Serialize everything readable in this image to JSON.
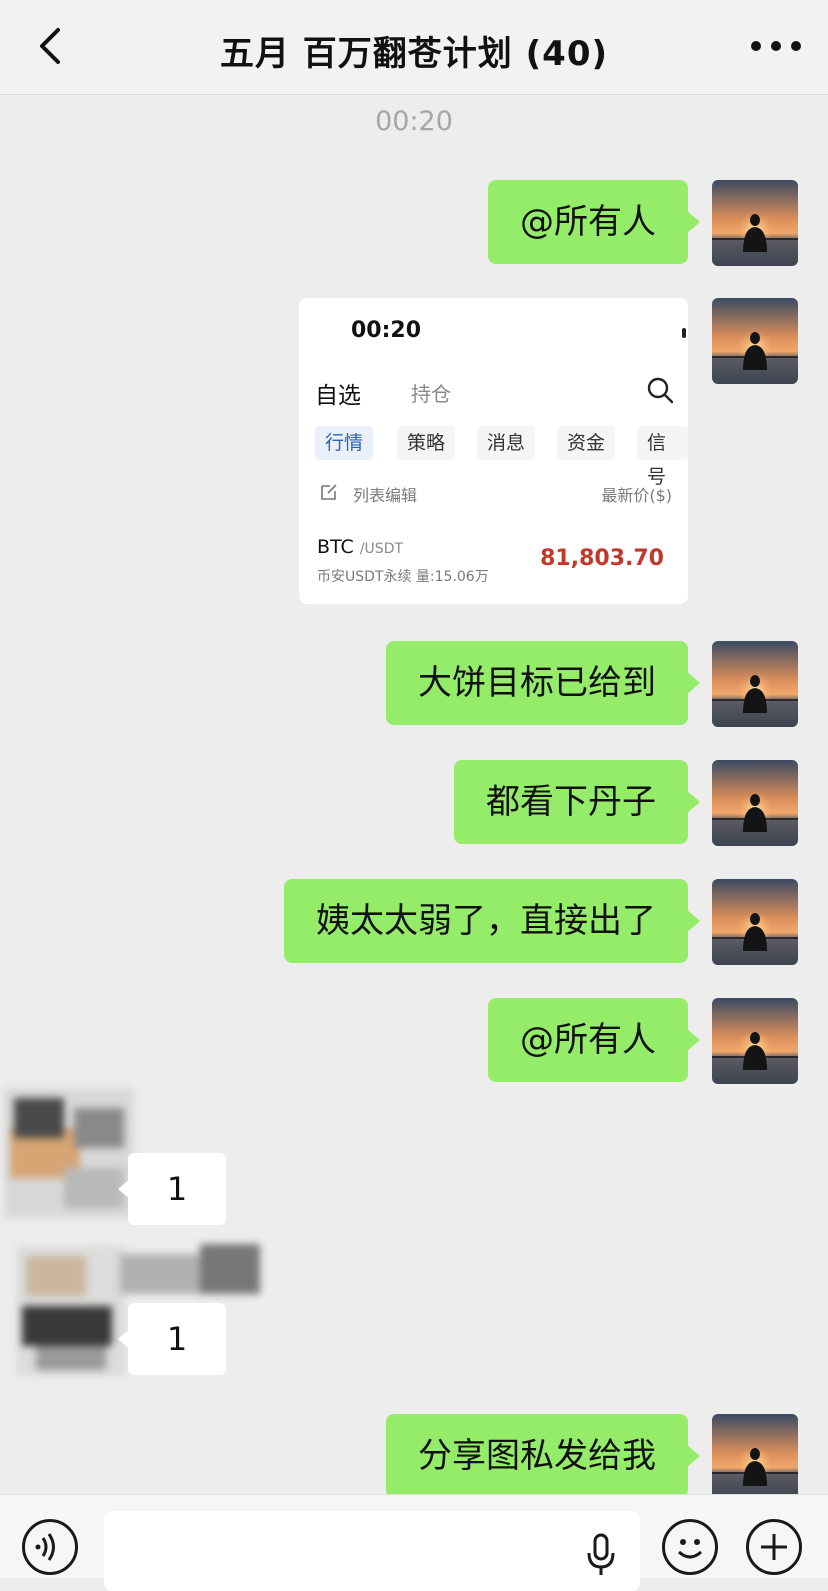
{
  "header": {
    "title": "五月 百万翻苍计划 (40)"
  },
  "timestamp": "00:20",
  "messages": [
    {
      "text": "@所有人"
    },
    {
      "text": "大饼目标已给到"
    },
    {
      "text": "都看下丹子"
    },
    {
      "text": "姨太太弱了，直接出了"
    },
    {
      "text": "@所有人"
    },
    {
      "text": "分享图私发给我"
    }
  ],
  "incoming": [
    {
      "text": "1"
    },
    {
      "text": "1"
    }
  ],
  "shared_image": {
    "time": "00:20",
    "tab_selected": "自选",
    "tab_other": "持仓",
    "chips": [
      "行情",
      "策略",
      "消息",
      "资金",
      "信号"
    ],
    "list_edit": "列表编辑",
    "price_header": "最新价($)",
    "symbol": "BTC",
    "pair": "/USDT",
    "sub": "币安USDT永续  量:15.06万",
    "price": "81,803.70"
  },
  "colors": {
    "outgoing_bubble": "#95ec69",
    "price_red": "#c0392b",
    "chip_active": "#2a64b6"
  },
  "icons": [
    "back-icon",
    "more-icon",
    "search-icon",
    "edit-icon",
    "voice-icon",
    "mic-icon",
    "emoji-icon",
    "plus-icon"
  ]
}
